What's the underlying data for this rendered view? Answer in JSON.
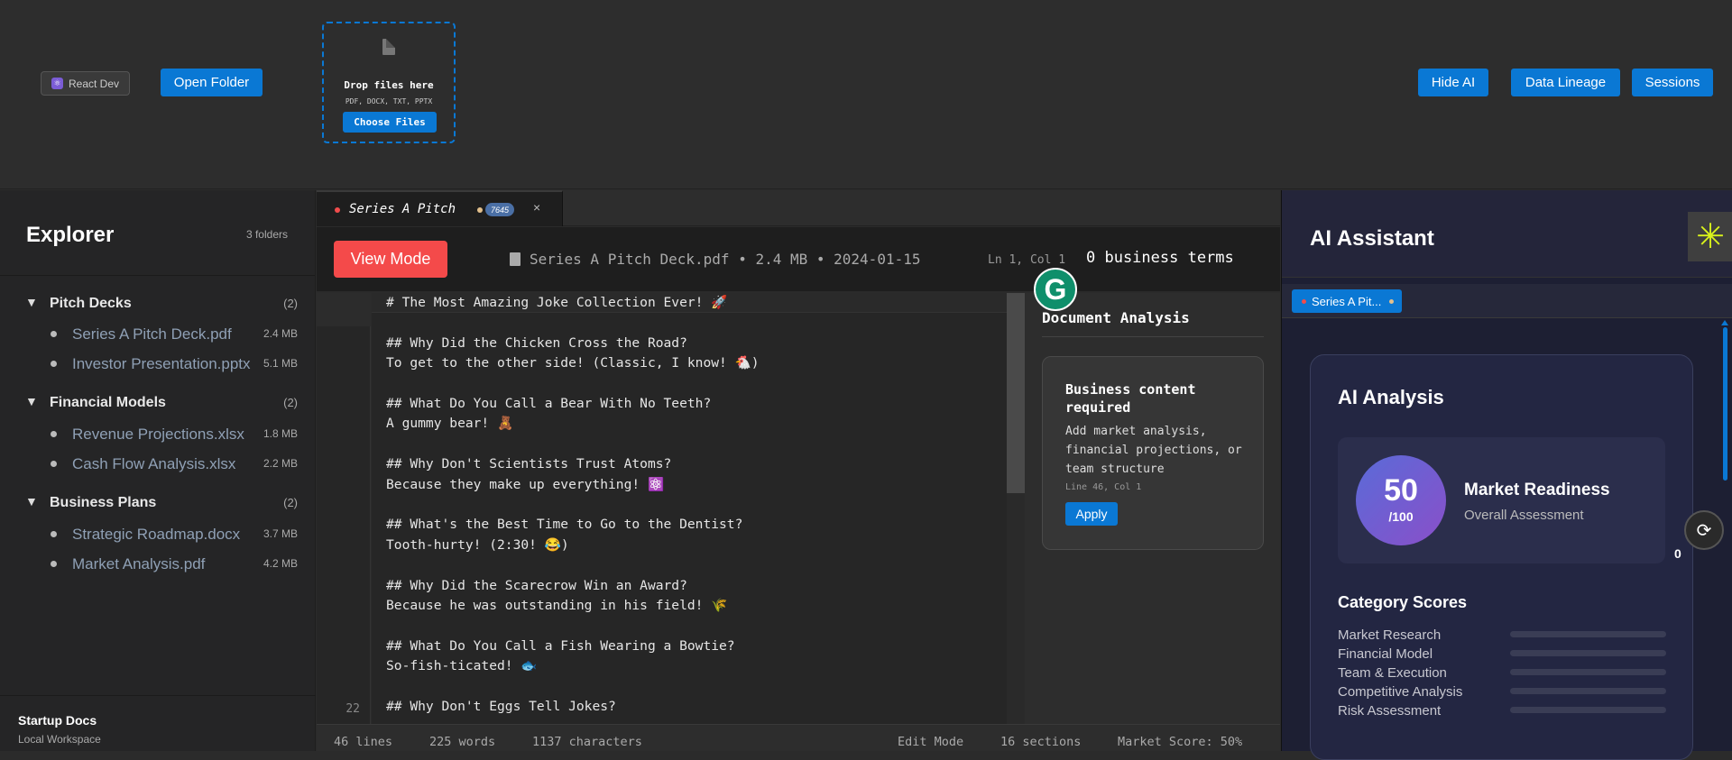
{
  "topbar": {
    "profile": "React Dev",
    "open_folder": "Open Folder",
    "dropzone": {
      "title": "Drop files here",
      "types": "PDF, DOCX, TXT, PPTX",
      "button": "Choose Files"
    },
    "hide_ai": "Hide AI",
    "data_lineage": "Data Lineage",
    "sessions": "Sessions"
  },
  "sidebar": {
    "title": "Explorer",
    "folder_count": "3 folders",
    "folders": [
      {
        "name": "Pitch Decks",
        "count": "(2)",
        "files": [
          {
            "name": "Series A Pitch Deck.pdf",
            "size": "2.4 MB"
          },
          {
            "name": "Investor Presentation.pptx",
            "size": "5.1 MB"
          }
        ]
      },
      {
        "name": "Financial Models",
        "count": "(2)",
        "files": [
          {
            "name": "Revenue Projections.xlsx",
            "size": "1.8 MB"
          },
          {
            "name": "Cash Flow Analysis.xlsx",
            "size": "2.2 MB"
          }
        ]
      },
      {
        "name": "Business Plans",
        "count": "(2)",
        "files": [
          {
            "name": "Strategic Roadmap.docx",
            "size": "3.7 MB"
          },
          {
            "name": "Market Analysis.pdf",
            "size": "4.2 MB"
          }
        ]
      }
    ],
    "workspace_name": "Startup Docs",
    "workspace_type": "Local Workspace"
  },
  "editor": {
    "tab_label": "Series A Pitch",
    "tab_badge": "7645",
    "tab_close": "×",
    "view_mode": "View Mode",
    "doc_meta": "Series A Pitch Deck.pdf • 2.4 MB • 2024-01-15",
    "cursor": "Ln 1, Col 1",
    "business_terms": "0 business terms",
    "line_number": "22",
    "code": "# The Most Amazing Joke Collection Ever! 🚀\n\n## Why Did the Chicken Cross the Road?\nTo get to the other side! (Classic, I know! 🐔)\n\n## What Do You Call a Bear With No Teeth?\nA gummy bear! 🧸\n\n## Why Don't Scientists Trust Atoms?\nBecause they make up everything! ⚛️\n\n## What's the Best Time to Go to the Dentist?\nTooth-hurty! (2:30! 😂)\n\n## Why Did the Scarecrow Win an Award?\nBecause he was outstanding in his field! 🌾\n\n## What Do You Call a Fish Wearing a Bowtie?\nSo-fish-ticated! 🐟\n\n## Why Don't Eggs Tell Jokes?"
  },
  "analysis": {
    "title": "Document Analysis",
    "card_title": "Business content required",
    "card_desc": "Add market analysis, financial projections, or team structure",
    "card_loc": "Line 46, Col 1",
    "apply": "Apply"
  },
  "statusbar": {
    "lines": "46 lines",
    "words": "225 words",
    "chars": "1137 characters",
    "mode": "Edit Mode",
    "sections": "16 sections",
    "market_score": "Market Score: 50%"
  },
  "ai": {
    "title": "AI Assistant",
    "tab": "Series A Pit...",
    "analysis_title": "AI Analysis",
    "score": "50",
    "score_den": "/100",
    "readiness_title": "Market Readiness",
    "readiness_sub": "Overall Assessment",
    "category_title": "Category Scores",
    "categories": [
      {
        "name": "Market Research",
        "score": 0
      },
      {
        "name": "Financial Model",
        "score": 0
      },
      {
        "name": "Team & Execution",
        "score": 0
      },
      {
        "name": "Competitive Analysis",
        "score": 0
      },
      {
        "name": "Risk Assessment",
        "score": 0
      }
    ],
    "float_count": "0"
  },
  "colors": {
    "accent": "#0a78d4",
    "view_mode": "#f44a4a",
    "ai_bg": "#1d1f33"
  },
  "icons": {
    "profile": "atom-icon",
    "drop": "file-icon",
    "grammar": "grammarly-g-icon",
    "spark": "sparkle-icon",
    "float": "ai-float-icon"
  }
}
